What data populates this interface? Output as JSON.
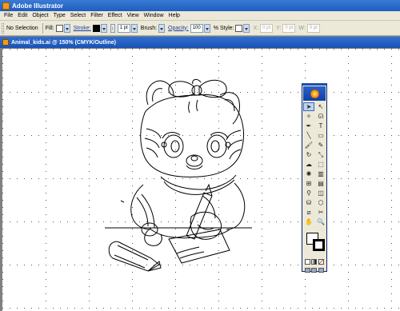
{
  "window": {
    "title": "Adobe Illustrator",
    "icon": "illustrator-app-icon"
  },
  "menu": [
    "File",
    "Edit",
    "Object",
    "Type",
    "Select",
    "Filter",
    "Effect",
    "View",
    "Window",
    "Help"
  ],
  "control_bar": {
    "selection_status": "No Selection",
    "fill_label": "Fill:",
    "stroke_label": "Stroke:",
    "stroke_weight": "1 pt",
    "brush_label": "Brush:",
    "opacity_label": "Opacity:",
    "opacity_value": "100",
    "opacity_unit": "%",
    "style_label": "Style:",
    "x_label": "X:",
    "x_value": "0 pt",
    "y_label": "Y:",
    "y_value": "0 pt",
    "w_label": "W:",
    "w_value": "0 pt"
  },
  "document": {
    "tab_title": "Animal_kids.ai @ 150% (CMYK/Outline)",
    "icon": "document-icon"
  },
  "toolbox": {
    "logo": "illustrator-flower-logo",
    "tools": [
      {
        "name": "selection-tool",
        "glyph": "➤",
        "active": true
      },
      {
        "name": "direct-selection-tool",
        "glyph": "↖",
        "active": false
      },
      {
        "name": "magic-wand-tool",
        "glyph": "✧",
        "active": false
      },
      {
        "name": "lasso-tool",
        "glyph": "ᘏ",
        "active": false
      },
      {
        "name": "pen-tool",
        "glyph": "✒",
        "active": false
      },
      {
        "name": "type-tool",
        "glyph": "T",
        "active": false
      },
      {
        "name": "line-tool",
        "glyph": "╲",
        "active": false
      },
      {
        "name": "rectangle-tool",
        "glyph": "▭",
        "active": false
      },
      {
        "name": "paintbrush-tool",
        "glyph": "🖌",
        "active": false
      },
      {
        "name": "pencil-tool",
        "glyph": "✎",
        "active": false
      },
      {
        "name": "rotate-tool",
        "glyph": "↻",
        "active": false
      },
      {
        "name": "scale-tool",
        "glyph": "⤡",
        "active": false
      },
      {
        "name": "warp-tool",
        "glyph": "☁",
        "active": false
      },
      {
        "name": "free-transform-tool",
        "glyph": "⬚",
        "active": false
      },
      {
        "name": "symbol-sprayer-tool",
        "glyph": "✺",
        "active": false
      },
      {
        "name": "graph-tool",
        "glyph": "▥",
        "active": false
      },
      {
        "name": "mesh-tool",
        "glyph": "⊞",
        "active": false
      },
      {
        "name": "gradient-tool",
        "glyph": "▤",
        "active": false
      },
      {
        "name": "eyedropper-tool",
        "glyph": "⚲",
        "active": false
      },
      {
        "name": "blend-tool",
        "glyph": "◫",
        "active": false
      },
      {
        "name": "live-paint-bucket-tool",
        "glyph": "⛁",
        "active": false
      },
      {
        "name": "live-paint-selection-tool",
        "glyph": "⬡",
        "active": false
      },
      {
        "name": "slice-tool",
        "glyph": "⧄",
        "active": false
      },
      {
        "name": "scissors-tool",
        "glyph": "✂",
        "active": false
      },
      {
        "name": "hand-tool",
        "glyph": "✋",
        "active": false
      },
      {
        "name": "zoom-tool",
        "glyph": "🔍",
        "active": false
      }
    ],
    "fill_color": "#ffffff",
    "stroke_color": "#000000"
  },
  "colors": {
    "title_bar": "#1f5cc0",
    "chrome": "#ece9d8",
    "workspace": "#808080",
    "canvas": "#ffffff"
  }
}
